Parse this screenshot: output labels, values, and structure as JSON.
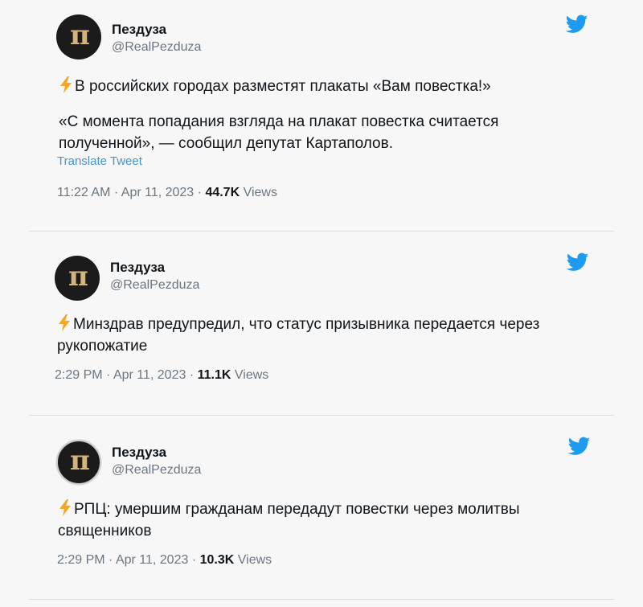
{
  "tweets": [
    {
      "author_name": "Пездуза",
      "handle": "@RealPezduza",
      "avatar_letter": "п",
      "paragraphs": [
        "В российских городах разместят плакаты «Вам повестка!»",
        "«С момента попадания взгляда на плакат повестка считается полученной», — сообщил депутат Картаполов."
      ],
      "translate_label": "Translate Tweet",
      "time": "11:22 AM",
      "separator": "·",
      "date": "Apr 11, 2023",
      "views_count": "44.7K",
      "views_label": "Views"
    },
    {
      "author_name": "Пездуза",
      "handle": "@RealPezduza",
      "avatar_letter": "п",
      "paragraphs": [
        "Минздрав предупредил, что статус призывника передается через рукопожатие"
      ],
      "time": "2:29 PM",
      "separator": "·",
      "date": "Apr 11, 2023",
      "views_count": "11.1K",
      "views_label": "Views"
    },
    {
      "author_name": "Пездуза",
      "handle": "@RealPezduza",
      "avatar_letter": "п",
      "paragraphs": [
        "РПЦ: умершим гражданам передадут повестки через молитвы священников"
      ],
      "time": "2:29 PM",
      "separator": "·",
      "date": "Apr 11, 2023",
      "views_count": "10.3K",
      "views_label": "Views"
    }
  ],
  "icons": {
    "brand": "twitter-bird-icon",
    "emoji": "lightning-bolt-icon"
  },
  "colors": {
    "twitter_blue": "#1d9bf0",
    "bolt": "#f5a623",
    "link": "#4b93c8",
    "avatar_bg": "#1b1b1b",
    "avatar_letter": "#d3b47d"
  }
}
